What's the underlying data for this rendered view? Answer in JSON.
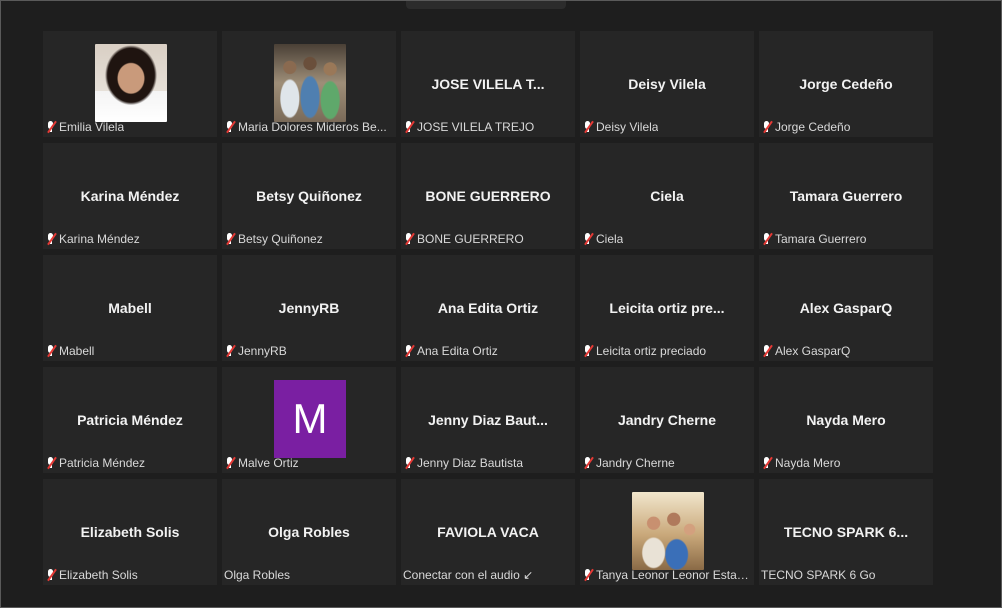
{
  "tiles": [
    {
      "display": "",
      "label": "Emilia Vilela",
      "muted": true,
      "media": "photo-girl",
      "media_icon": "participant-photo"
    },
    {
      "display": "",
      "label": "Maria Dolores Mideros Be...",
      "muted": true,
      "media": "photo-group",
      "media_icon": "participant-photo"
    },
    {
      "display": "JOSE   VILELA  T...",
      "label": "JOSE   VILELA  TREJO",
      "muted": true
    },
    {
      "display": "Deisy Vilela",
      "label": "Deisy Vilela",
      "muted": true
    },
    {
      "display": "Jorge Cedeño",
      "label": "Jorge Cedeño",
      "muted": true
    },
    {
      "display": "Karina Méndez",
      "label": "Karina Méndez",
      "muted": true
    },
    {
      "display": "Betsy Quiñonez",
      "label": "Betsy Quiñonez",
      "muted": true
    },
    {
      "display": "BONE GUERRERO",
      "label": "BONE GUERRERO",
      "muted": true
    },
    {
      "display": "Ciela",
      "label": "Ciela",
      "muted": true
    },
    {
      "display": "Tamara Guerrero",
      "label": "Tamara Guerrero",
      "muted": true
    },
    {
      "display": "Mabell",
      "label": "Mabell",
      "muted": true
    },
    {
      "display": "JennyRB",
      "label": "JennyRB",
      "muted": true
    },
    {
      "display": "Ana Edita Ortiz",
      "label": "Ana Edita Ortiz",
      "muted": true
    },
    {
      "display": "Leicita  ortiz  pre...",
      "label": "Leicita ortiz preciado",
      "muted": true
    },
    {
      "display": "Alex GasparQ",
      "label": "Alex GasparQ",
      "muted": true
    },
    {
      "display": "Patricia Méndez",
      "label": "Patricia Méndez",
      "muted": true
    },
    {
      "display": "",
      "label": "Malve Ortiz",
      "muted": true,
      "media": "letter",
      "letter": "M",
      "letter_color": "#7a1fa2"
    },
    {
      "display": "Jenny  Diaz  Baut...",
      "label": "Jenny Diaz Bautista",
      "muted": true
    },
    {
      "display": "Jandry Cherne",
      "label": "Jandry Cherne",
      "muted": true
    },
    {
      "display": "Nayda Mero",
      "label": "Nayda Mero",
      "muted": true
    },
    {
      "display": "Elizabeth Solis",
      "label": "Elizabeth Solis",
      "muted": true
    },
    {
      "display": "Olga Robles",
      "label": "Olga Robles",
      "muted": false
    },
    {
      "display": "FAVIOLA VACA",
      "label": "Conectar con el audio ↙",
      "muted": false
    },
    {
      "display": "",
      "label": "Tanya Leonor Leonor Estac...",
      "muted": true,
      "media": "photo-family",
      "media_icon": "participant-photo"
    },
    {
      "display": "TECNO SPARK 6...",
      "label": "TECNO SPARK 6 Go",
      "muted": false
    }
  ],
  "colors": {
    "tile_bg": "#262626",
    "page_bg": "#1e1e1e",
    "mute_slash": "#e53935"
  }
}
